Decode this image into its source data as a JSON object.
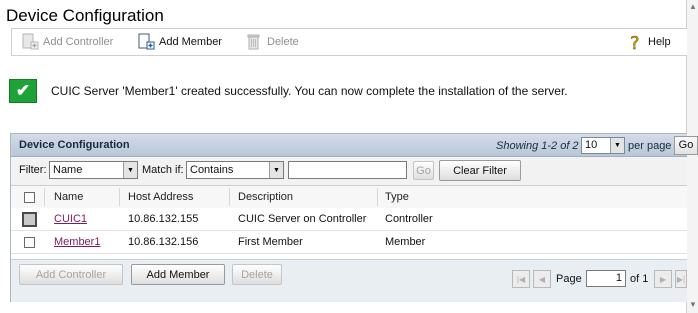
{
  "page": {
    "title": "Device Configuration"
  },
  "toolbar": {
    "add_controller": "Add Controller",
    "add_member": "Add Member",
    "delete": "Delete",
    "help": "Help"
  },
  "message": {
    "status": "success",
    "icon": "checkmark-icon",
    "text": "CUIC Server 'Member1' created successfully. You can now complete the installation of the server."
  },
  "panel": {
    "title": "Device Configuration",
    "showing": "Showing 1-2 of 2",
    "per_page_value": "10",
    "per_page_label": "per page",
    "go_label": "Go"
  },
  "filter": {
    "label": "Filter:",
    "field_value": "Name",
    "match_label": "Match if:",
    "match_value": "Contains",
    "text_value": "",
    "go_label": "Go",
    "clear_label": "Clear Filter"
  },
  "table": {
    "columns": [
      "Name",
      "Host Address",
      "Description",
      "Type"
    ],
    "rows": [
      {
        "name": "CUIC1",
        "host": "10.86.132.155",
        "description": "CUIC Server on Controller",
        "type": "Controller"
      },
      {
        "name": "Member1",
        "host": "10.86.132.156",
        "description": "First Member",
        "type": "Member"
      }
    ]
  },
  "footer": {
    "add_controller": "Add Controller",
    "add_member": "Add Member",
    "delete": "Delete"
  },
  "pagination": {
    "page_label": "Page",
    "page_value": "1",
    "of_label": "of 1"
  },
  "colors": {
    "success_green": "#1ea339",
    "panel_header": "#c6d3e1",
    "link": "#7a1c5e"
  }
}
